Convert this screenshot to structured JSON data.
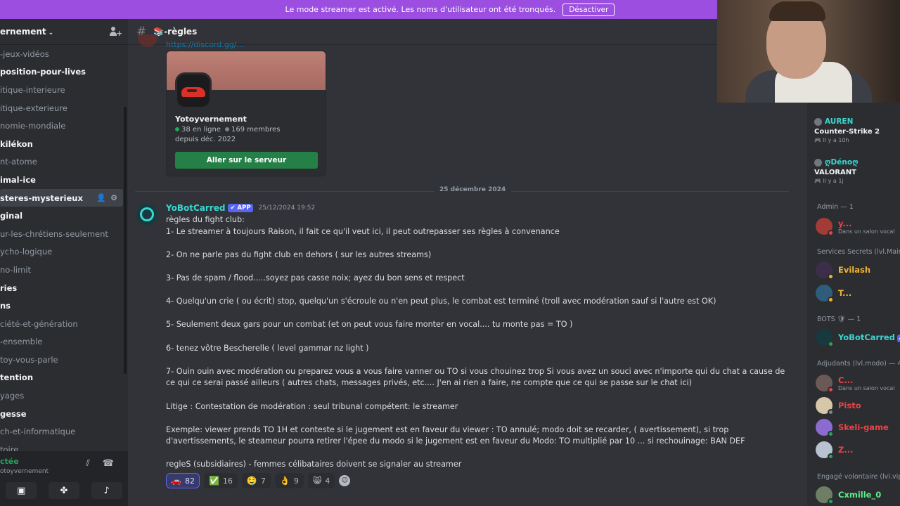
{
  "banner": {
    "text": "Le mode streamer est activé. Les noms d'utilisateur ont été tronqués.",
    "button": "Désactiver"
  },
  "server": {
    "name": "ernement",
    "chevron": "⌄",
    "channels": [
      {
        "label": "-jeux-vidéos",
        "state": "read"
      },
      {
        "label": "position-pour-lives",
        "state": "unread"
      },
      {
        "label": "itique-interieure",
        "state": "read"
      },
      {
        "label": "itique-exterieure",
        "state": "read"
      },
      {
        "label": "nomie-mondiale",
        "state": "read"
      },
      {
        "label": "kilékon",
        "state": "unread"
      },
      {
        "label": "nt-atome",
        "state": "read"
      },
      {
        "label": "imal-ice",
        "state": "unread"
      },
      {
        "label": "steres-mysterieux",
        "state": "active"
      },
      {
        "label": "ginal",
        "state": "unread"
      },
      {
        "label": "ur-les-chrétiens-seulement",
        "state": "read"
      },
      {
        "label": "ycho-logique",
        "state": "read"
      },
      {
        "label": "no-limit",
        "state": "read"
      },
      {
        "label": "ries",
        "state": "unread"
      },
      {
        "label": "ns",
        "state": "unread"
      },
      {
        "label": "ciété-et-génération",
        "state": "read"
      },
      {
        "label": "-ensemble",
        "state": "read"
      },
      {
        "label": "toy-vous-parle",
        "state": "read"
      },
      {
        "label": "tention",
        "state": "unread"
      },
      {
        "label": "yages",
        "state": "read"
      },
      {
        "label": "gesse",
        "state": "unread"
      },
      {
        "label": "ch-et-informatique",
        "state": "read"
      },
      {
        "label": "toire",
        "state": "read"
      }
    ]
  },
  "user_panel": {
    "status": "ctée",
    "server": "otoyvernement"
  },
  "channel": {
    "title": "📚-règles"
  },
  "invite": {
    "link": "https://discord.gg/...",
    "server_name": "Yotoyvernement",
    "online": "38 en ligne",
    "members": "169 membres",
    "since": "depuis déc. 2022",
    "join_button": "Aller sur le serveur"
  },
  "date_divider": "25 décembre 2024",
  "message": {
    "author": "YoBotCarred",
    "badge": "✔ APP",
    "timestamp": "25/12/2024 19:52",
    "lines": [
      "règles du fight club:",
      "1- Le streamer à toujours Raison, il fait ce qu'il veut ici, il peut outrepasser ses règles à convenance",
      "",
      "2- On ne parle pas du fight club en dehors ( sur les autres streams)",
      "",
      "3- Pas de spam / flood.....soyez pas casse noix; ayez du bon sens et respect",
      "",
      "4- Quelqu'un crie ( ou écrit) stop, quelqu'un s'écroule ou n'en peut plus, le combat est terminé (troll avec modération sauf si l'autre est OK)",
      "",
      "5- Seulement deux gars pour un combat (et on peut vous faire monter en vocal.... tu monte pas = TO )",
      "",
      "6- tenez vôtre Bescherelle ( level gammar nz light )",
      "",
      "7- Ouin ouin avec modération ou preparez vous a vous faire vanner ou TO si vous chouinez trop Si vous avez un souci avec n'importe qui du chat a cause de ce qui ce serai passé ailleurs ( autres chats, messages privés, etc.... J'en ai rien a faire, ne compte que ce qui se passe sur le chat ici)",
      "",
      "Litige : Contestation de modération : seul tribunal compétent: le streamer",
      "",
      "Exemple: viewer prends TO 1H et conteste si le jugement est en faveur du viewer : TO annulé; modo doit se recarder, ( avertissement), si trop d'avertissements, le steameur pourra retirer l'épee du modo si le jugement est en faveur du Modo: TO multiplié par 10 ... si rechouinage: BAN DEF",
      "",
      "regleS (subsidiaires) - femmes célibataires doivent se signaler au streamer"
    ]
  },
  "reactions": [
    {
      "emoji": "🚗",
      "count": "82",
      "mine": true
    },
    {
      "emoji": "✅",
      "count": "16",
      "mine": false
    },
    {
      "emoji": "🤤",
      "count": "7",
      "mine": false
    },
    {
      "emoji": "👌",
      "count": "9",
      "mine": false
    },
    {
      "emoji": "😸",
      "count": "4",
      "mine": false
    }
  ],
  "members_panel": {
    "activities": [
      {
        "name": "AUREN",
        "game": "Counter-Strike 2",
        "when": "🎮 Il y a 10h",
        "color": "#3ad6d0"
      },
      {
        "name": "ღDénoღ",
        "game": "VALORANT",
        "when": "🎮 Il y a 1j",
        "color": "#3ad6d0"
      }
    ],
    "groups": [
      {
        "label": "Admin — 1"
      },
      {
        "label": "Services Secrets (lvl.Maint"
      },
      {
        "label": "BOTS 🛡 — 1"
      },
      {
        "label": "Adjudants (lvl.modo) — 4"
      },
      {
        "label": "Engagé volontaire (lvl.vip)"
      }
    ],
    "members": [
      {
        "name": "y...",
        "sub": "Dans un salon vocal",
        "color": "#ed4245"
      },
      {
        "name": "Evilash",
        "sub": "",
        "color": "#f0b232"
      },
      {
        "name": "T...",
        "sub": "",
        "color": "#f0b232"
      },
      {
        "name": "YoBotCarred",
        "sub": "",
        "color": "#3ad6d0"
      },
      {
        "name": "C...",
        "sub": "Dans un salon vocal",
        "color": "#ed4245"
      },
      {
        "name": "Pisto",
        "sub": "",
        "color": "#ed4245"
      },
      {
        "name": "Skeli-game",
        "sub": "",
        "color": "#ed4245"
      },
      {
        "name": "Z...",
        "sub": "",
        "color": "#ed4245"
      },
      {
        "name": "Cxmille_0",
        "sub": "",
        "color": "#57f287"
      }
    ]
  }
}
